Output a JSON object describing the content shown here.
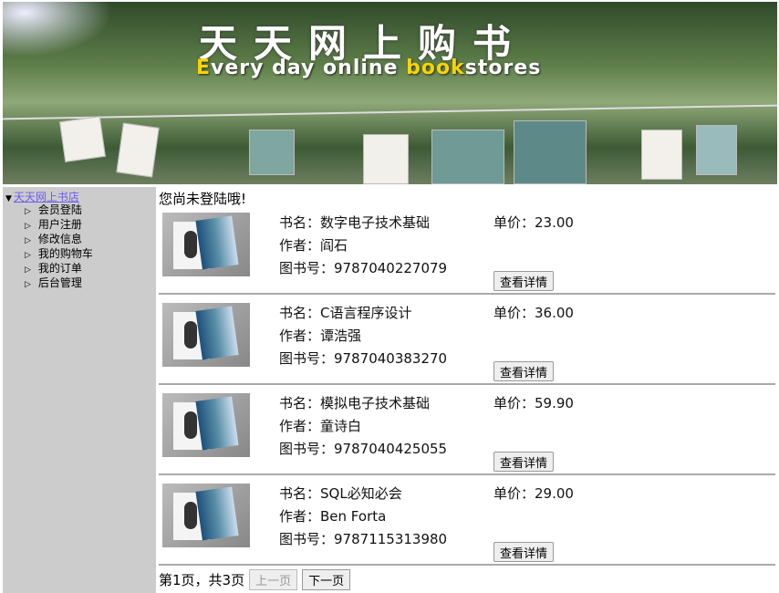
{
  "banner": {
    "title": "天天网上购书",
    "subtitle_a": "E",
    "subtitle_b": "very day online ",
    "subtitle_c": "book",
    "subtitle_d": "stores"
  },
  "sidebar": {
    "root": "天天网上书店",
    "items": [
      "会员登陆",
      "用户注册",
      "修改信息",
      "我的购物车",
      "我的订单",
      "后台管理"
    ]
  },
  "login_status": "您尚未登陆哦!",
  "labels": {
    "name": "书名：",
    "author": "作者：",
    "isbn": "图书号：",
    "price": "单价：",
    "detail": "查看详情"
  },
  "books": [
    {
      "name": "数字电子技术基础",
      "author": "阎石",
      "isbn": "9787040227079",
      "price": "23.00"
    },
    {
      "name": "C语言程序设计",
      "author": "谭浩强",
      "isbn": "9787040383270",
      "price": "36.00"
    },
    {
      "name": "模拟电子技术基础",
      "author": "童诗白",
      "isbn": "9787040425055",
      "price": "59.90"
    },
    {
      "name": "SQL必知必会",
      "author": "Ben Forta",
      "isbn": "9787115313980",
      "price": "29.00"
    }
  ],
  "pager": {
    "text": "第1页，共3页",
    "prev": "上一页",
    "next": "下一页"
  }
}
